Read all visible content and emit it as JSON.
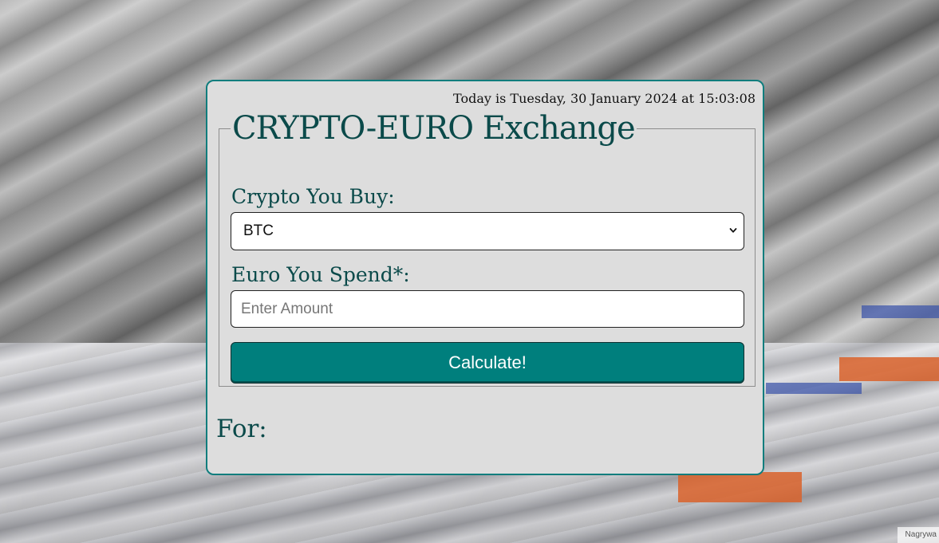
{
  "header": {
    "date_text": "Today is Tuesday, 30 January 2024 at 15:03:08"
  },
  "form": {
    "title": "CRYPTO-EURO Exchange",
    "crypto_label": "Crypto You Buy:",
    "crypto_selected": "BTC",
    "euro_label": "Euro You Spend*:",
    "euro_placeholder": "Enter Amount",
    "euro_value": "",
    "calculate_label": "Calculate!"
  },
  "result": {
    "for_label": "For:"
  },
  "corner": {
    "watermark_text": "Nagrywa"
  },
  "icons": {
    "dropdown": "chevron-down-icon"
  },
  "colors": {
    "accent": "#007f7d",
    "border": "#0e7d7d",
    "heading_text": "#0b4a4a",
    "card_bg": "#dddddd"
  }
}
